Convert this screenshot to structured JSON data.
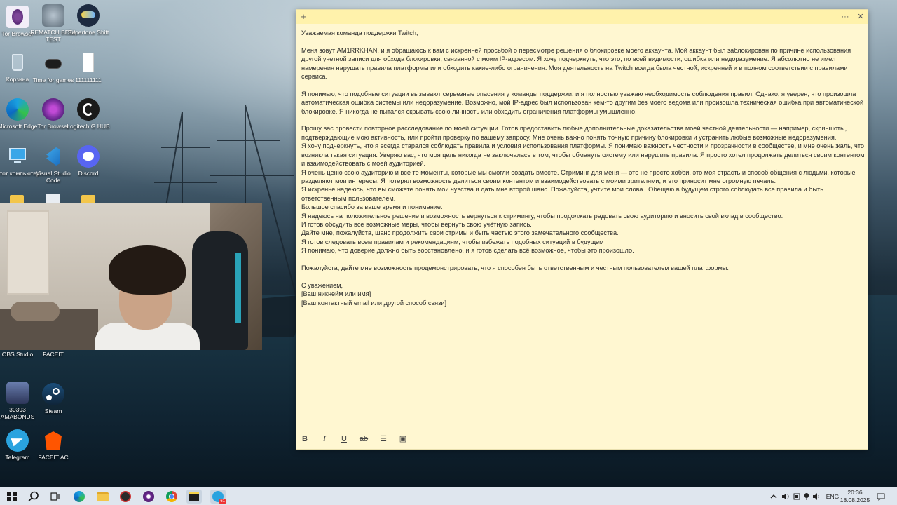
{
  "desktop": {
    "icons": [
      {
        "label": "Tor Browser",
        "icon": "tor-browser-icon"
      },
      {
        "label": "REMATCH BETA TEST",
        "icon": "rematch-icon"
      },
      {
        "label": "Supertone Shift",
        "icon": "supertone-icon"
      },
      {
        "label": "Корзина",
        "icon": "recycle-bin-icon"
      },
      {
        "label": "Time for games",
        "icon": "time-for-games-icon"
      },
      {
        "label": "111111111",
        "icon": "file-icon"
      },
      {
        "label": "Microsoft Edge",
        "icon": "edge-icon"
      },
      {
        "label": "Tor Browser",
        "icon": "tor-browser-icon"
      },
      {
        "label": "Logitech G HUB",
        "icon": "logitech-icon"
      },
      {
        "label": "Этот компьютер",
        "icon": "this-pc-icon"
      },
      {
        "label": "Visual Studio Code",
        "icon": "vscode-icon"
      },
      {
        "label": "Discord",
        "icon": "discord-icon"
      },
      {
        "label": "OBS Studio",
        "icon": "obs-icon"
      },
      {
        "label": "FACEIT",
        "icon": "faceit-icon"
      },
      {
        "label": "30393 AMABONUS",
        "icon": "amabonus-icon"
      },
      {
        "label": "Steam",
        "icon": "steam-icon"
      },
      {
        "label": "Telegram",
        "icon": "telegram-icon"
      },
      {
        "label": "FACEIT AC",
        "icon": "faceit-ac-icon"
      }
    ]
  },
  "note": {
    "add_glyph": "+",
    "menu_glyph": "···",
    "close_glyph": "✕",
    "paragraphs": [
      "Уважаемая команда поддержки Twitch,",
      "",
      "Меня зовут AM1RRKHAN, и я обращаюсь к вам с искренней просьбой о пересмотре решения о блокировке моего аккаунта. Мой аккаунт был заблокирован по причине использования другой учетной записи для обхода блокировки, связанной с моим IP-адресом. Я хочу подчеркнуть, что это, по всей видимости, ошибка или недоразумение. Я абсолютно не имел намерения нарушать правила платформы или обходить какие-либо ограничения. Моя деятельность на Twitch всегда была честной, искренней и в полном соответствии с правилами сервиса.",
      "",
      "Я понимаю, что подобные ситуации вызывают серьезные опасения у команды поддержки, и я полностью уважаю необходимость соблюдения правил. Однако, я уверен, что произошла автоматическая ошибка системы или недоразумение. Возможно, мой IP-адрес был использован кем-то другим без моего ведома или произошла техническая ошибка при автоматической блокировке. Я никогда не пытался скрывать свою личность или обходить ограничения платформы умышленно.",
      "",
      "Прошу вас провести повторное расследование по моей ситуации. Готов предоставить любые дополнительные доказательства моей честной деятельности — например, скриншоты, подтверждающие мою активность, или пройти проверку по вашему запросу. Мне очень важно понять точную причину блокировки и устранить любые возможные недоразумения.",
      "Я хочу подчеркнуть, что я всегда старался соблюдать правила и условия использования платформы. Я понимаю важность честности и прозрачности в сообществе, и мне очень жаль, что возникла такая ситуация. Уверяю вас, что моя цель никогда не заключалась в том, чтобы обмануть систему или нарушить правила. Я просто хотел продолжать делиться своим контентом и взаимодействовать с моей аудиторией.",
      "Я очень ценю свою аудиторию и все те моменты, которые мы смогли создать вместе. Стриминг для меня — это не просто хобби, это моя страсть и способ общения с людьми, которые разделяют мои интересы. Я потерял возможность делиться своим контентом и взаимодействовать с моими зрителями, и это приносит мне огромную печаль.",
      "Я искренне надеюсь, что вы сможете понять мои чувства и дать мне второй шанс. Пожалуйста, учтите мои слова.. Обещаю в будущем строго соблюдать все правила и быть ответственным пользователем.",
      "Большое спасибо за ваше время и понимание.",
      "Я надеюсь на положительное решение и возможность вернуться к стримингу, чтобы продолжать радовать свою аудиторию и вносить свой вклад в сообщество.",
      "И готов обсудить все возможные меры, чтобы вернуть свою учётную запись.",
      "Дайте мне, пожалуйста, шанс продолжить свои стримы и быть частью этого замечательного сообщества.",
      "Я готов следовать всем правилам и рекомендациям, чтобы избежать подобных ситуаций в будущем",
      "Я понимаю, что доверие должно быть восстановлено, и я готов сделать всё возможное, чтобы это произошло.",
      "",
      "Пожалуйста, дайте мне возможность продемонстрировать, что я способен быть ответственным и честным пользователем вашей платформы.",
      "",
      "С уважением,",
      "[Ваш никнейм или имя]",
      "[Ваш контактный email или другой способ связи]"
    ],
    "toolbar": {
      "bold": "B",
      "italic": "I",
      "underline": "U",
      "strike": "ab",
      "list": "☰",
      "image": "▣"
    }
  },
  "taskbar": {
    "language": "ENG",
    "time": "20:36",
    "date": "18.08.2025",
    "telegram_badge": "61"
  }
}
